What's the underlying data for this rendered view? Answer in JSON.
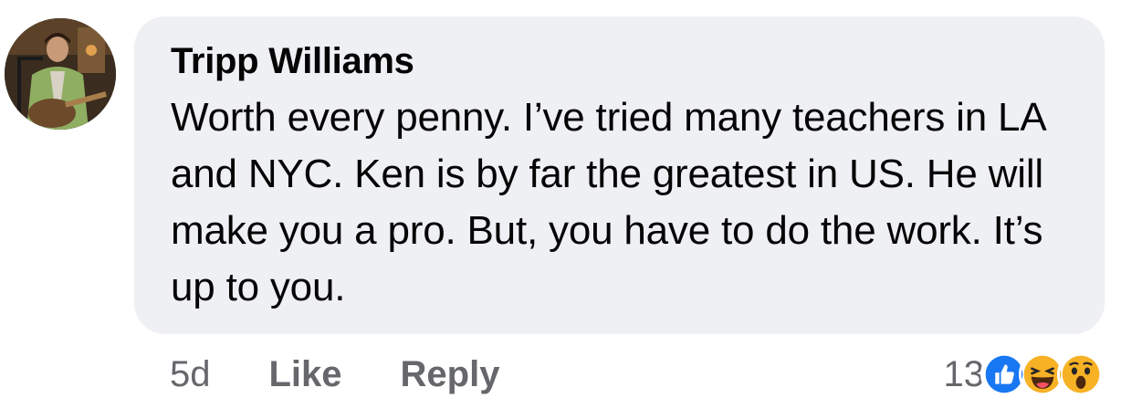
{
  "comment": {
    "author": "Tripp Williams",
    "text": "Worth every penny. I’ve tried many teachers in LA and NYC. Ken is by far the greatest in US. He will make you a pro. But, you have to do the work. It’s up to you.",
    "timestamp": "5d",
    "like_label": "Like",
    "reply_label": "Reply",
    "reaction_count": "13",
    "reactions": [
      "like-icon",
      "haha-icon",
      "wow-icon"
    ]
  },
  "colors": {
    "bubble_bg": "#eff0f4",
    "text": "#050505",
    "secondary_text": "#65676b",
    "like_blue": "#1877f2",
    "emoji_yellow": "#f7b125"
  }
}
